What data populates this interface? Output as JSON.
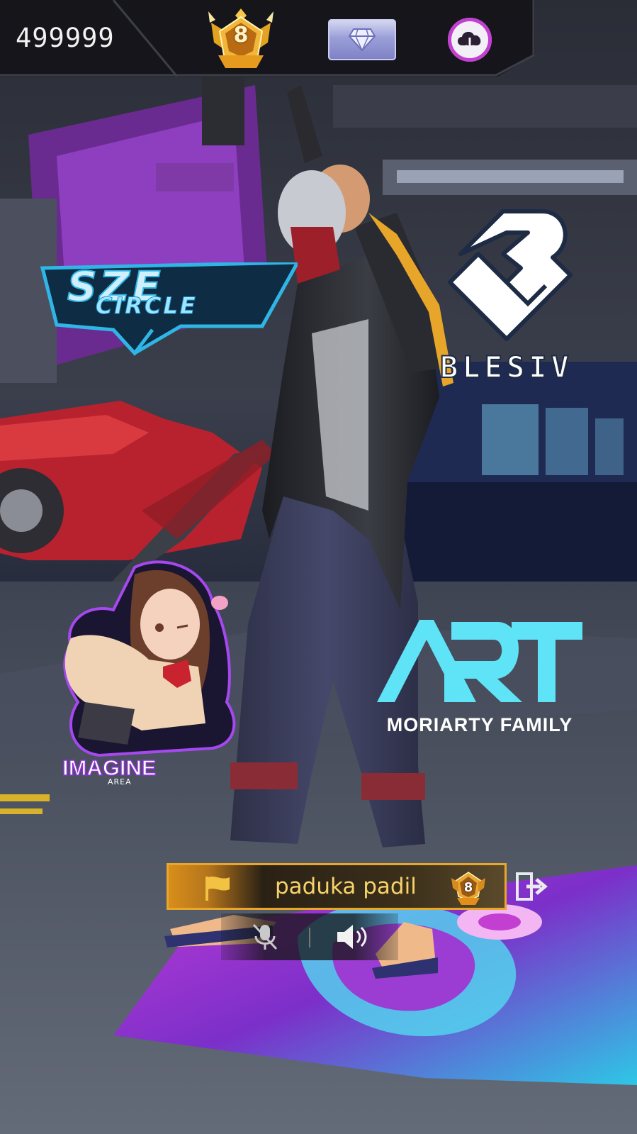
{
  "hud": {
    "currency_value": "499999",
    "rank_level": "8",
    "diamond_icon": "diamond-icon",
    "cloud_icon": "cloud-download-icon"
  },
  "logos": {
    "sze": {
      "line1": "SZE",
      "line2": "CIRCLE"
    },
    "blesiv": {
      "text": "BLESIV"
    },
    "art": {
      "caption": "MORIARTY FAMILY"
    },
    "imagine": {
      "title": "IMAGINE",
      "subtitle": "AREA"
    }
  },
  "player": {
    "name": "paduka padil",
    "rank_level": "8",
    "flag_icon": "flag-icon",
    "exit_icon": "exit-icon"
  },
  "voice": {
    "mic_icon": "mic-muted-icon",
    "speaker_icon": "speaker-icon"
  },
  "colors": {
    "accent_gold": "#e8a72a",
    "accent_cyan": "#35d4f3",
    "accent_purple": "#c23fd2"
  }
}
